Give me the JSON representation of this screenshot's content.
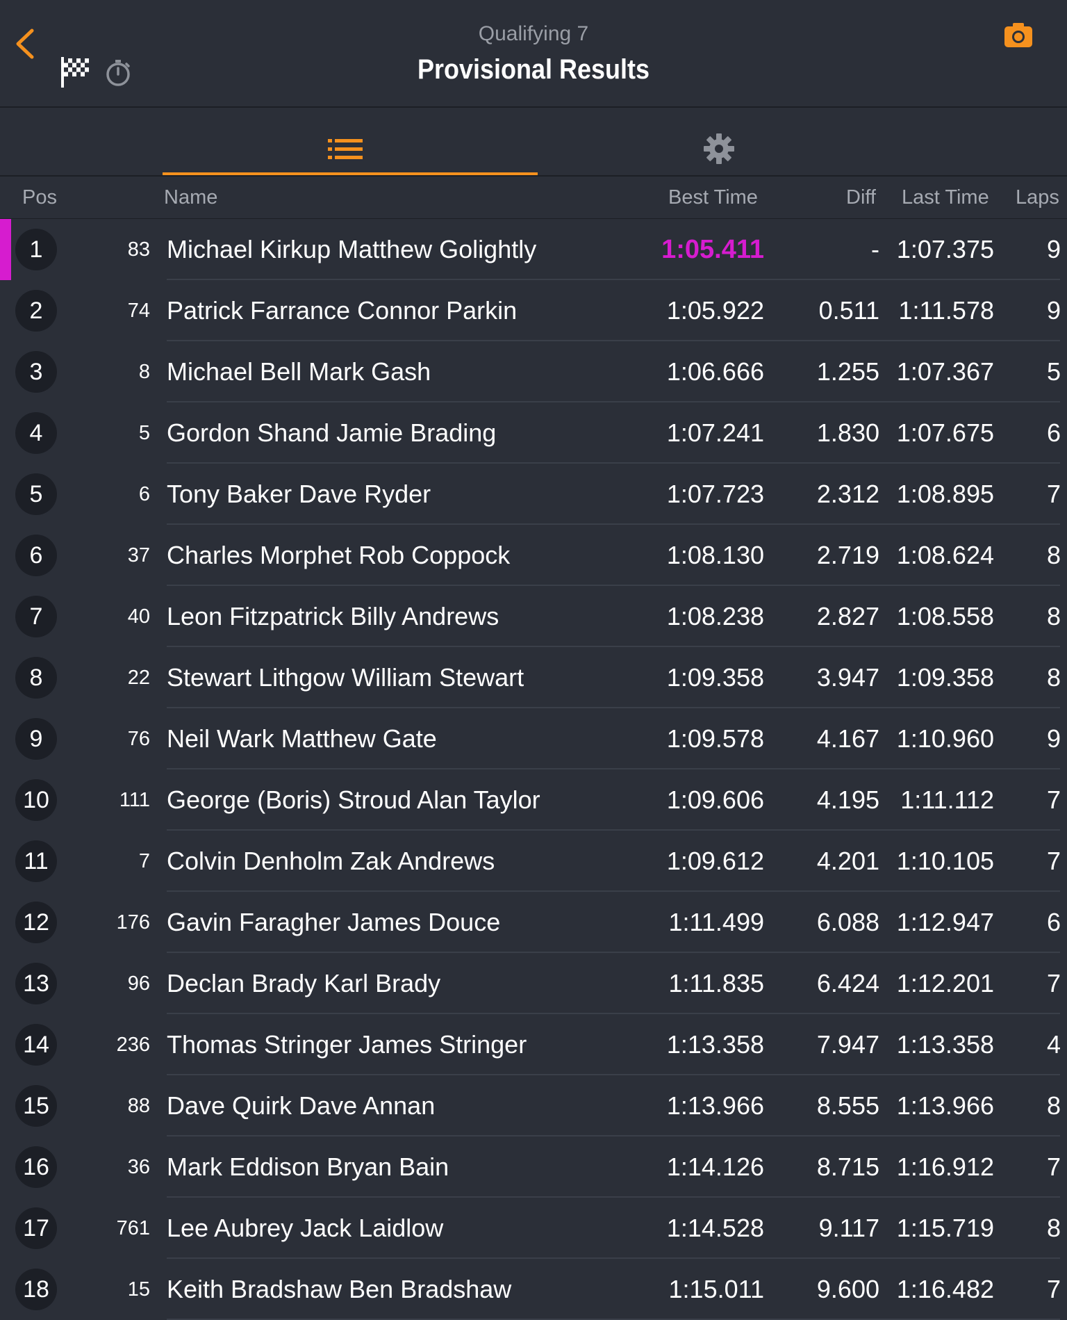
{
  "header": {
    "subtitle": "Qualifying 7",
    "title": "Provisional Results"
  },
  "colors": {
    "accent": "#f5911e",
    "fastest_lap": "#d61ccf",
    "background": "#2b2f38"
  },
  "icons": {
    "back": "chevron-left-icon",
    "flag": "checkered-flag-icon",
    "timer": "stopwatch-icon",
    "camera": "camera-icon",
    "list_tab": "list-icon",
    "settings_tab": "gear-icon"
  },
  "columns": {
    "pos": "Pos",
    "name": "Name",
    "best": "Best Time",
    "diff": "Diff",
    "last": "Last Time",
    "laps": "Laps"
  },
  "results": [
    {
      "pos": "1",
      "num": "83",
      "name": "Michael Kirkup Matthew Golightly",
      "best": "1:05.411",
      "diff": "-",
      "last": "1:07.375",
      "laps": "9",
      "fastest": true
    },
    {
      "pos": "2",
      "num": "74",
      "name": "Patrick Farrance Connor Parkin",
      "best": "1:05.922",
      "diff": "0.511",
      "last": "1:11.578",
      "laps": "9"
    },
    {
      "pos": "3",
      "num": "8",
      "name": "Michael Bell Mark Gash",
      "best": "1:06.666",
      "diff": "1.255",
      "last": "1:07.367",
      "laps": "5"
    },
    {
      "pos": "4",
      "num": "5",
      "name": "Gordon Shand Jamie Brading",
      "best": "1:07.241",
      "diff": "1.830",
      "last": "1:07.675",
      "laps": "6"
    },
    {
      "pos": "5",
      "num": "6",
      "name": "Tony Baker Dave Ryder",
      "best": "1:07.723",
      "diff": "2.312",
      "last": "1:08.895",
      "laps": "7"
    },
    {
      "pos": "6",
      "num": "37",
      "name": "Charles Morphet Rob Coppock",
      "best": "1:08.130",
      "diff": "2.719",
      "last": "1:08.624",
      "laps": "8"
    },
    {
      "pos": "7",
      "num": "40",
      "name": "Leon Fitzpatrick Billy Andrews",
      "best": "1:08.238",
      "diff": "2.827",
      "last": "1:08.558",
      "laps": "8"
    },
    {
      "pos": "8",
      "num": "22",
      "name": "Stewart Lithgow William Stewart",
      "best": "1:09.358",
      "diff": "3.947",
      "last": "1:09.358",
      "laps": "8"
    },
    {
      "pos": "9",
      "num": "76",
      "name": "Neil Wark Matthew Gate",
      "best": "1:09.578",
      "diff": "4.167",
      "last": "1:10.960",
      "laps": "9"
    },
    {
      "pos": "10",
      "num": "111",
      "name": "George (Boris) Stroud Alan Taylor",
      "best": "1:09.606",
      "diff": "4.195",
      "last": "1:11.112",
      "laps": "7"
    },
    {
      "pos": "11",
      "num": "7",
      "name": "Colvin Denholm Zak Andrews",
      "best": "1:09.612",
      "diff": "4.201",
      "last": "1:10.105",
      "laps": "7"
    },
    {
      "pos": "12",
      "num": "176",
      "name": "Gavin Faragher James Douce",
      "best": "1:11.499",
      "diff": "6.088",
      "last": "1:12.947",
      "laps": "6"
    },
    {
      "pos": "13",
      "num": "96",
      "name": "Declan Brady Karl Brady",
      "best": "1:11.835",
      "diff": "6.424",
      "last": "1:12.201",
      "laps": "7"
    },
    {
      "pos": "14",
      "num": "236",
      "name": "Thomas Stringer James Stringer",
      "best": "1:13.358",
      "diff": "7.947",
      "last": "1:13.358",
      "laps": "4"
    },
    {
      "pos": "15",
      "num": "88",
      "name": "Dave Quirk Dave Annan",
      "best": "1:13.966",
      "diff": "8.555",
      "last": "1:13.966",
      "laps": "8"
    },
    {
      "pos": "16",
      "num": "36",
      "name": "Mark Eddison Bryan Bain",
      "best": "1:14.126",
      "diff": "8.715",
      "last": "1:16.912",
      "laps": "7"
    },
    {
      "pos": "17",
      "num": "761",
      "name": "Lee Aubrey Jack Laidlow",
      "best": "1:14.528",
      "diff": "9.117",
      "last": "1:15.719",
      "laps": "8"
    },
    {
      "pos": "18",
      "num": "15",
      "name": "Keith Bradshaw Ben Bradshaw",
      "best": "1:15.011",
      "diff": "9.600",
      "last": "1:16.482",
      "laps": "7"
    }
  ]
}
